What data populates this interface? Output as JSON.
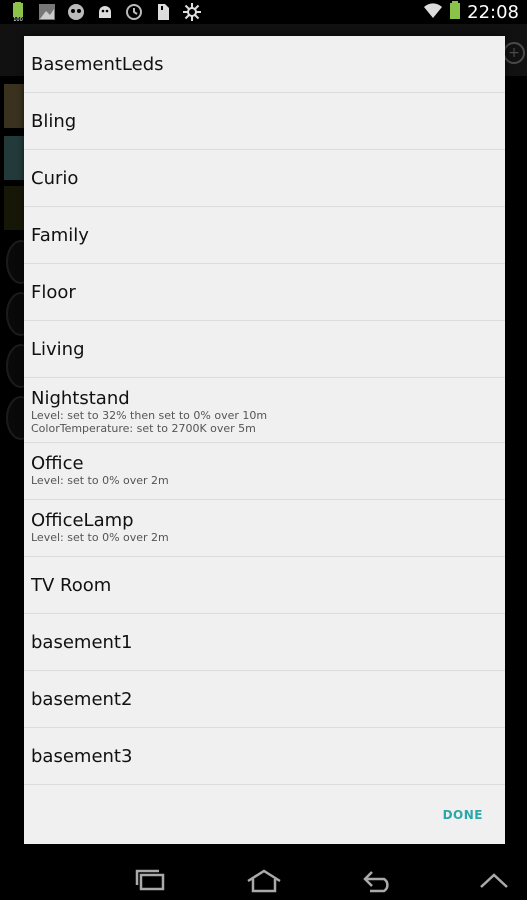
{
  "status_bar": {
    "time": "22:08",
    "icons": [
      "battery-100-icon",
      "image-icon",
      "android-icon",
      "android-debug-icon",
      "clock-icon",
      "sd-card-icon",
      "settings-gear-icon"
    ]
  },
  "dialog": {
    "items": [
      {
        "name": "BasementLeds",
        "details": []
      },
      {
        "name": "Bling",
        "details": []
      },
      {
        "name": "Curio",
        "details": []
      },
      {
        "name": "Family",
        "details": []
      },
      {
        "name": "Floor",
        "details": []
      },
      {
        "name": "Living",
        "details": []
      },
      {
        "name": "Nightstand",
        "details": [
          "Level: set to 32% then set to 0% over 10m",
          "ColorTemperature: set to 2700K  over 5m"
        ]
      },
      {
        "name": "Office",
        "details": [
          "Level: set to 0% over 2m"
        ]
      },
      {
        "name": "OfficeLamp",
        "details": [
          "Level: set to 0% over 2m"
        ]
      },
      {
        "name": "TV Room",
        "details": []
      },
      {
        "name": "basement1",
        "details": []
      },
      {
        "name": "basement2",
        "details": []
      },
      {
        "name": "basement3",
        "details": []
      }
    ],
    "done_label": "DONE"
  },
  "nav_bar": {
    "buttons": [
      "recent-apps-icon",
      "home-icon",
      "back-icon",
      "menu-up-icon"
    ]
  },
  "colors": {
    "accent": "#2aa7a7",
    "dialog_bg": "#f0f0f0"
  }
}
